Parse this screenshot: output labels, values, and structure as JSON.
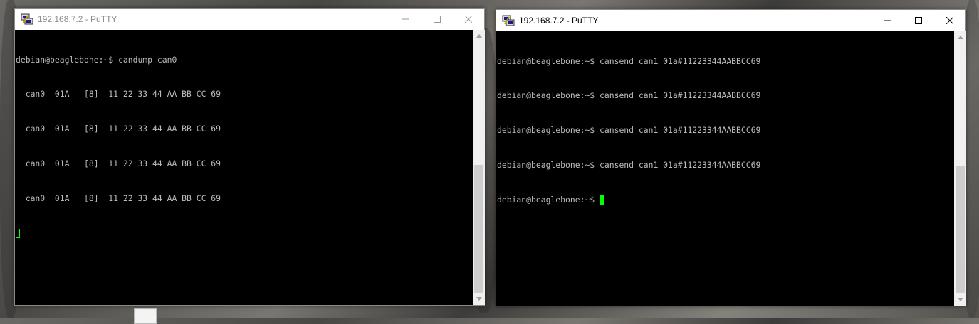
{
  "windows": [
    {
      "title": "192.168.7.2 - PuTTY",
      "active": false,
      "lines": [
        "debian@beaglebone:~$ candump can0",
        "  can0  01A   [8]  11 22 33 44 AA BB CC 69",
        "  can0  01A   [8]  11 22 33 44 AA BB CC 69",
        "  can0  01A   [8]  11 22 33 44 AA BB CC 69",
        "  can0  01A   [8]  11 22 33 44 AA BB CC 69"
      ]
    },
    {
      "title": "192.168.7.2 - PuTTY",
      "active": true,
      "lines": [
        "debian@beaglebone:~$ cansend can1 01a#11223344AABBCC69",
        "debian@beaglebone:~$ cansend can1 01a#11223344AABBCC69",
        "debian@beaglebone:~$ cansend can1 01a#11223344AABBCC69",
        "debian@beaglebone:~$ cansend can1 01a#11223344AABBCC69",
        "debian@beaglebone:~$ "
      ]
    }
  ],
  "colors": {
    "terminal_bg": "#000000",
    "terminal_fg": "#bbbbbb",
    "cursor": "#00ff00"
  },
  "icons": [
    "putty-icon",
    "minimize-icon",
    "maximize-icon",
    "close-icon",
    "scroll-up-arrow-icon",
    "scroll-down-arrow-icon"
  ]
}
